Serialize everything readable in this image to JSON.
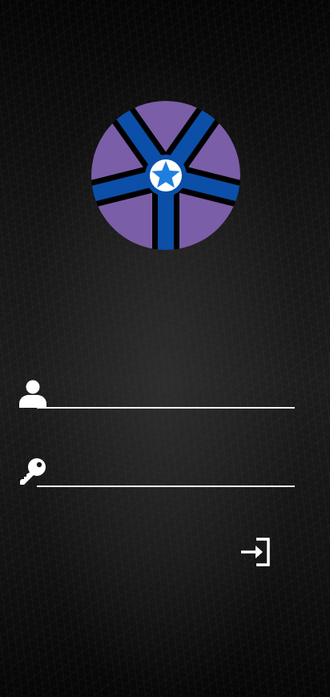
{
  "logo": {
    "icon": "star-wheel-logo",
    "outer_color": "#7b5ea8",
    "spoke_color": "#0b4fa8",
    "star_color": "#1e7fe0"
  },
  "username": {
    "icon": "user-icon",
    "value": "",
    "placeholder": ""
  },
  "password": {
    "icon": "key-icon",
    "value": "",
    "placeholder": ""
  },
  "login_button": {
    "icon": "login-icon",
    "label": ""
  },
  "colors": {
    "line": "#f2f2f2",
    "background": "#111111"
  }
}
